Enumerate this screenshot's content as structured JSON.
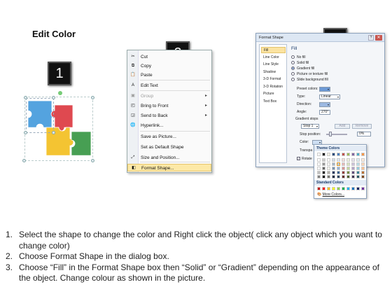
{
  "page_title": "Edit Color",
  "badges": [
    "1",
    "2",
    "3"
  ],
  "context_menu": {
    "items": [
      {
        "label": "Cut",
        "icon": "scissors-icon",
        "glyph": "✂",
        "state": "normal"
      },
      {
        "label": "Copy",
        "icon": "copy-icon",
        "glyph": "⧉",
        "state": "normal"
      },
      {
        "label": "Paste",
        "icon": "paste-icon",
        "glyph": "📋",
        "state": "normal"
      },
      {
        "label": "Edit Text",
        "icon": "edit-text-icon",
        "glyph": "A",
        "state": "normal"
      },
      {
        "label": "Group",
        "icon": "group-icon",
        "glyph": "▣",
        "state": "disabled",
        "submenu": true
      },
      {
        "label": "Bring to Front",
        "icon": "bring-to-front-icon",
        "glyph": "◰",
        "state": "normal",
        "submenu": true
      },
      {
        "label": "Send to Back",
        "icon": "send-to-back-icon",
        "glyph": "◲",
        "state": "normal",
        "submenu": true
      },
      {
        "label": "Hyperlink...",
        "icon": "hyperlink-icon",
        "glyph": "🌐",
        "state": "normal"
      },
      {
        "label": "Save as Picture...",
        "icon": "",
        "glyph": "",
        "state": "normal"
      },
      {
        "label": "Set as Default Shape",
        "icon": "",
        "glyph": "",
        "state": "normal"
      },
      {
        "label": "Size and Position...",
        "icon": "size-position-icon",
        "glyph": "⤢",
        "state": "normal"
      },
      {
        "label": "Format Shape...",
        "icon": "format-shape-icon",
        "glyph": "◧",
        "state": "highlighted"
      }
    ]
  },
  "dialog": {
    "title": "Format Shape",
    "close_glyph": "✕",
    "help_glyph": "?",
    "nav": [
      "Fill",
      "Line Color",
      "Line Style",
      "Shadow",
      "3-D Format",
      "3-D Rotation",
      "Picture",
      "Text Box"
    ],
    "selected_nav": "Fill",
    "section_label": "Fill",
    "fill_options": [
      {
        "label": "No fill",
        "checked": false
      },
      {
        "label": "Solid fill",
        "checked": false
      },
      {
        "label": "Gradient fill",
        "checked": true
      },
      {
        "label": "Picture or texture fill",
        "checked": false
      },
      {
        "label": "Slide background fill",
        "checked": false
      }
    ],
    "preset_colors_label": "Preset colors:",
    "type_label": "Type:",
    "type_value": "Linear",
    "direction_label": "Direction:",
    "angle_label": "Angle:",
    "angle_value": "270°",
    "gradient_stops_label": "Gradient stops",
    "stop_value": "Stop 1",
    "add_label": "Add",
    "remove_label": "Remove",
    "stop_position_label": "Stop position:",
    "stop_position_value": "0%",
    "color_label": "Color:",
    "transparency_label": "Transpa",
    "rotate_label": "Rotate"
  },
  "color_popup": {
    "theme_header": "Theme Colors",
    "standard_header": "Standard Colors",
    "more_colors": "More Colors...",
    "theme_top_row": [
      "#ffffff",
      "#000000",
      "#eeece1",
      "#1f497d",
      "#4f81bd",
      "#c0504d",
      "#9bbb59",
      "#8064a2",
      "#4bacc6",
      "#f79646"
    ],
    "standard_colors": [
      "#c00000",
      "#ff0000",
      "#ffc000",
      "#ffff00",
      "#92d050",
      "#00b050",
      "#00b0f0",
      "#0070c0",
      "#002060",
      "#7030a0"
    ]
  },
  "puzzle_colors": {
    "blue": "#2f8fd8",
    "red": "#d8222a",
    "yellow": "#f2b705",
    "green": "#1f8a2e"
  },
  "instructions": [
    "Select the shape to change the color and Right click the object( click any object which you want to change color)",
    "Choose Format Shape in the dialog box.",
    "Choose “Fill” in the Format Shape box then “Solid” or “Gradient” depending on the appearance of the object. Change colour as shown in the picture."
  ]
}
